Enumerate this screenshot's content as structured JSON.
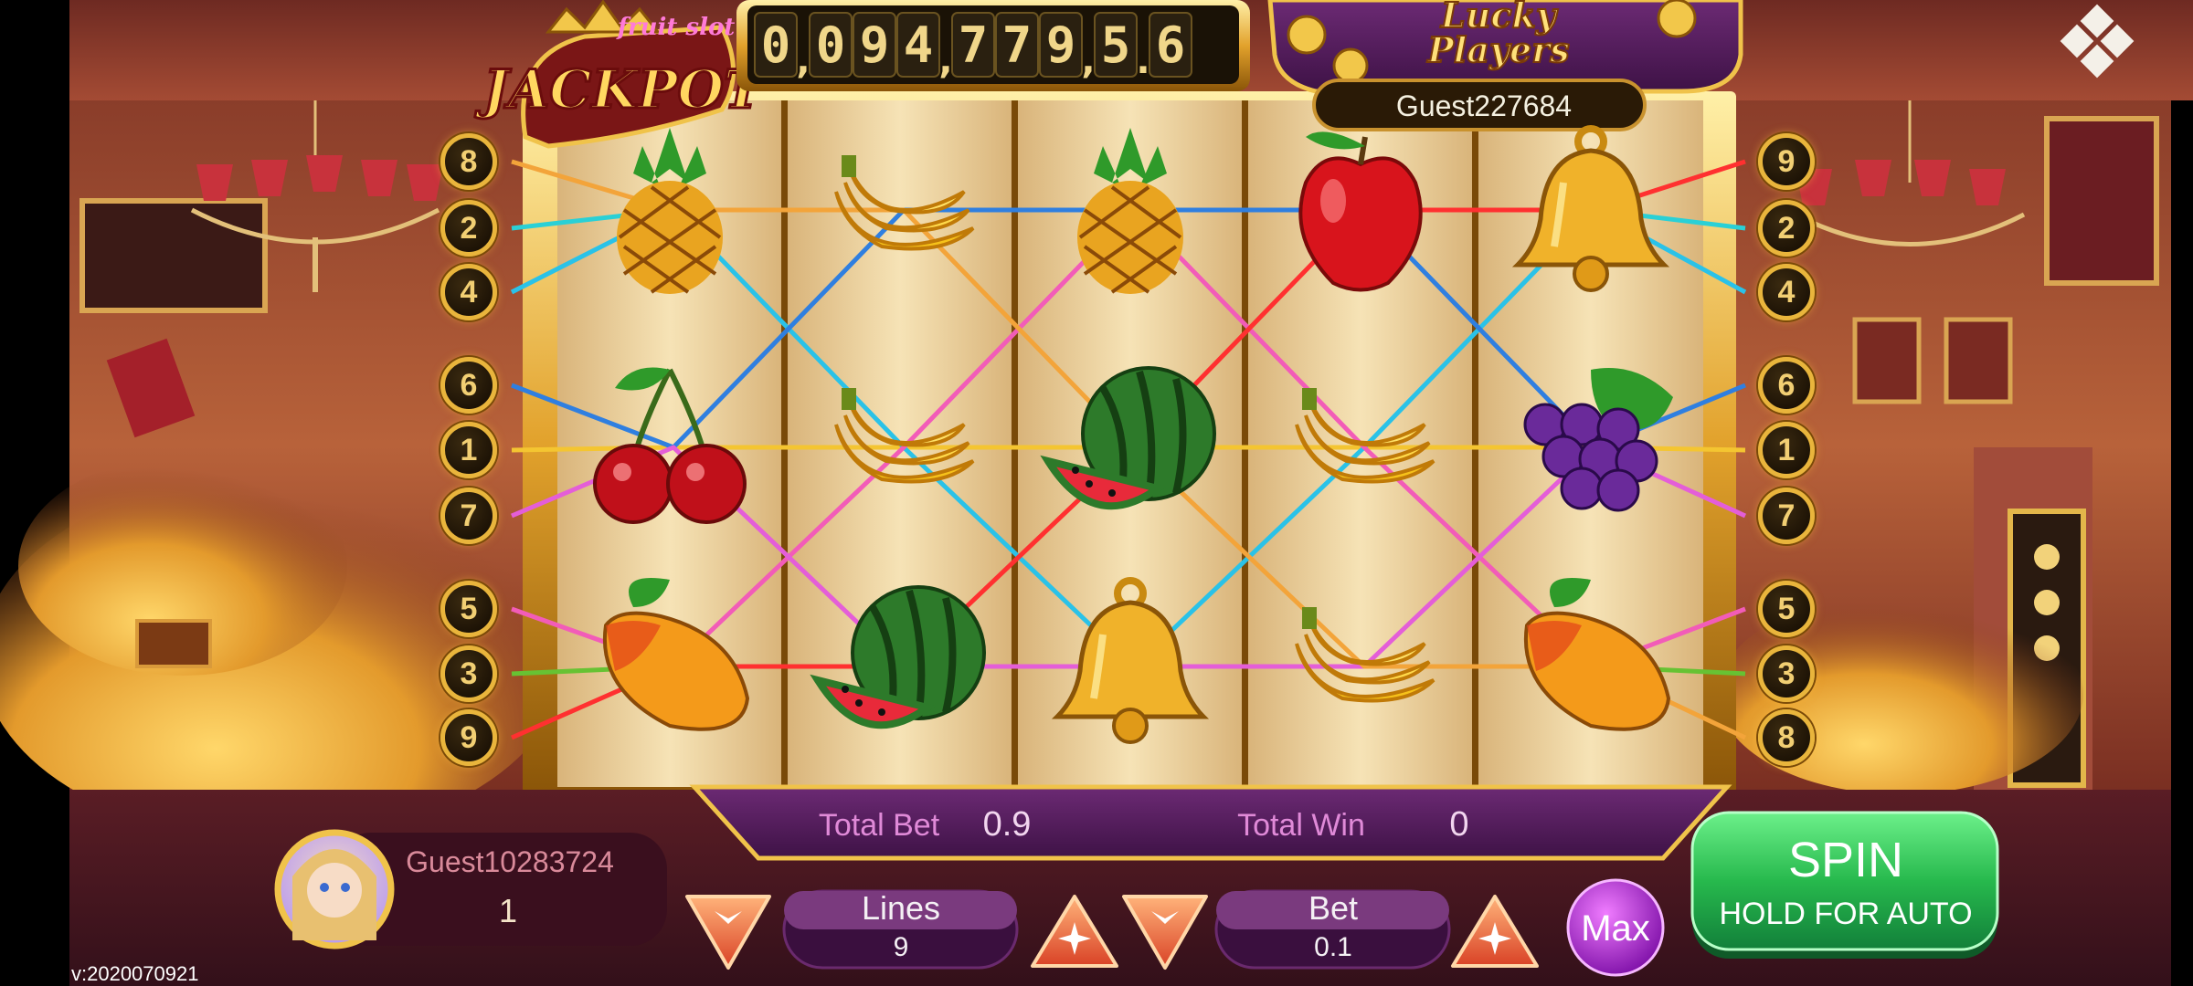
{
  "game": {
    "logo_top": "fruit slot",
    "logo_main": "JACKPOT",
    "jackpot_digits": [
      "0",
      "0",
      "9",
      "4",
      "7",
      "7",
      "9",
      "5",
      "6"
    ],
    "jackpot_separators": [
      ",",
      ",",
      ",",
      "."
    ],
    "lucky_title_line1": "Lucky",
    "lucky_title_line2": "Players",
    "lucky_player_name": "Guest227684"
  },
  "reels": [
    [
      "pineapple-icon",
      "cherry-icon",
      "mango-icon"
    ],
    [
      "banana-icon",
      "banana-icon",
      "watermelon-icon"
    ],
    [
      "pineapple-icon",
      "watermelon-icon",
      "bell-icon"
    ],
    [
      "apple-icon",
      "banana-icon",
      "banana-icon"
    ],
    [
      "bell-icon",
      "grape-icon",
      "mango-icon"
    ]
  ],
  "paylines": [
    {
      "number": "1",
      "color": "#f4c531",
      "rows": [
        1,
        1,
        1,
        1,
        1
      ]
    },
    {
      "number": "2",
      "color": "#2ad0d6",
      "rows": [
        0,
        0,
        0,
        0,
        0
      ]
    },
    {
      "number": "3",
      "color": "#67c233",
      "rows": [
        2,
        2,
        2,
        2,
        2
      ]
    },
    {
      "number": "4",
      "color": "#2ac2e8",
      "rows": [
        0,
        1,
        2,
        1,
        0
      ]
    },
    {
      "number": "5",
      "color": "#f25cb8",
      "rows": [
        2,
        1,
        0,
        1,
        2
      ]
    },
    {
      "number": "6",
      "color": "#2f7fe0",
      "rows": [
        1,
        0,
        0,
        0,
        1
      ]
    },
    {
      "number": "7",
      "color": "#e45ed8",
      "rows": [
        1,
        2,
        2,
        2,
        1
      ]
    },
    {
      "number": "8",
      "color": "#f3a43a",
      "rows": [
        0,
        0,
        1,
        2,
        2
      ]
    },
    {
      "number": "9",
      "color": "#ff3030",
      "rows": [
        2,
        2,
        1,
        0,
        0
      ]
    }
  ],
  "left_badges": [
    "8",
    "2",
    "4",
    "6",
    "1",
    "7",
    "5",
    "3",
    "9"
  ],
  "right_badges": [
    "9",
    "2",
    "4",
    "6",
    "1",
    "7",
    "5",
    "3",
    "8"
  ],
  "bet_panel": {
    "total_bet_label": "Total Bet",
    "total_bet_value": "0.9",
    "total_win_label": "Total Win",
    "total_win_value": "0"
  },
  "player": {
    "name": "Guest10283724",
    "balance": "1"
  },
  "controls": {
    "lines_label": "Lines",
    "lines_value": "9",
    "bet_label": "Bet",
    "bet_value": "0.1",
    "max_label": "Max",
    "spin_label": "SPIN",
    "spin_sublabel": "HOLD FOR AUTO"
  },
  "version": "v:2020070921",
  "colors": {
    "accent_gold": "#e9b53c",
    "purple_panel": "#5a1f62",
    "spin_green": "#2fbf5a",
    "max_purple": "#b025d0",
    "text_pink": "#e08ad8"
  }
}
